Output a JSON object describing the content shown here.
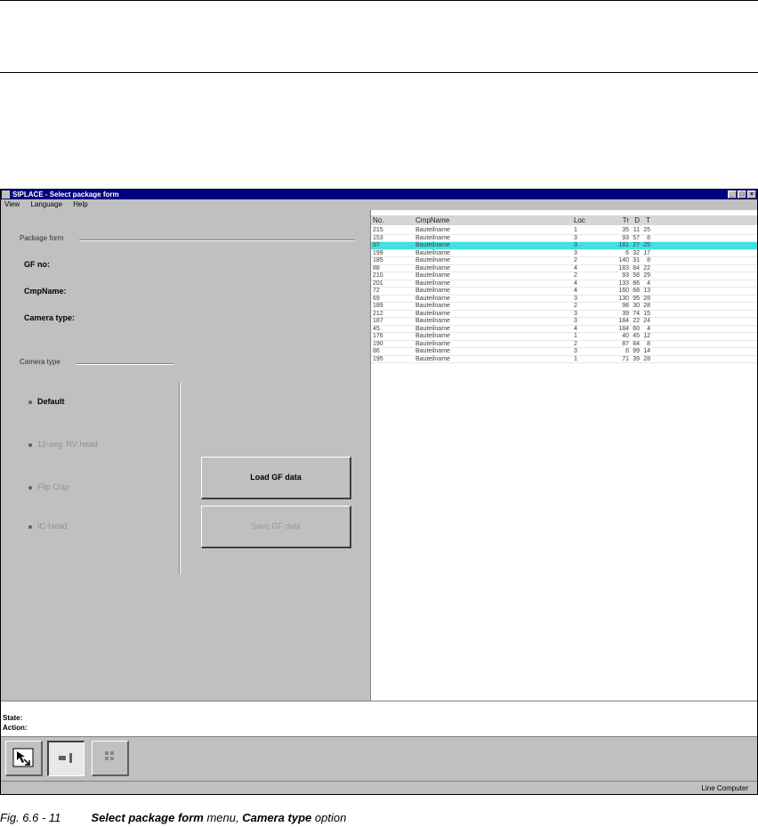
{
  "window": {
    "title": "SIPLACE - Select package form",
    "menu": [
      "View",
      "Language",
      "Help"
    ]
  },
  "left": {
    "group_package": "Package form",
    "fields": [
      "GF no:",
      "CmpName:",
      "Camera type:"
    ],
    "group_camera": "Camera type",
    "radios": [
      {
        "label": "Default",
        "enabled": true
      },
      {
        "label": "12-seg. RV head",
        "enabled": false
      },
      {
        "label": "Flip Chip",
        "enabled": false
      },
      {
        "label": "IC-Head",
        "enabled": false
      }
    ],
    "load_button": "Load GF data",
    "save_button": "Save GF data"
  },
  "list": {
    "columns": {
      "no": "No.",
      "name": "CmpName",
      "loc": "Loc",
      "tr": "Tr",
      "d": "D",
      "t": "T"
    },
    "rows": [
      {
        "no": "215",
        "name": "Bauteilname",
        "loc": "1",
        "tr": "35",
        "d": "11",
        "t": "25"
      },
      {
        "no": "153",
        "name": "Bauteilname",
        "loc": "3",
        "tr": "93",
        "d": "57",
        "t": "8"
      },
      {
        "no": "97",
        "name": "Bauteilname",
        "loc": "3",
        "tr": "181",
        "d": "27",
        "t": "25"
      },
      {
        "no": "199",
        "name": "Bauteilname",
        "loc": "3",
        "tr": "6",
        "d": "32",
        "t": "17"
      },
      {
        "no": "185",
        "name": "Bauteilname",
        "loc": "2",
        "tr": "140",
        "d": "31",
        "t": "8"
      },
      {
        "no": "88",
        "name": "Bauteilname",
        "loc": "4",
        "tr": "183",
        "d": "84",
        "t": "22"
      },
      {
        "no": "210",
        "name": "Bauteilname",
        "loc": "2",
        "tr": "93",
        "d": "58",
        "t": "29"
      },
      {
        "no": "201",
        "name": "Bauteilname",
        "loc": "4",
        "tr": "133",
        "d": "86",
        "t": "4"
      },
      {
        "no": "72",
        "name": "Bauteilname",
        "loc": "4",
        "tr": "160",
        "d": "68",
        "t": "13"
      },
      {
        "no": "69",
        "name": "Bauteilname",
        "loc": "3",
        "tr": "130",
        "d": "95",
        "t": "28"
      },
      {
        "no": "189",
        "name": "Bauteilname",
        "loc": "2",
        "tr": "98",
        "d": "30",
        "t": "28"
      },
      {
        "no": "212",
        "name": "Bauteilname",
        "loc": "3",
        "tr": "39",
        "d": "74",
        "t": "15"
      },
      {
        "no": "187",
        "name": "Bauteilname",
        "loc": "3",
        "tr": "184",
        "d": "22",
        "t": "24"
      },
      {
        "no": "45",
        "name": "Bauteilname",
        "loc": "4",
        "tr": "184",
        "d": "60",
        "t": "4"
      },
      {
        "no": "176",
        "name": "Bauteilname",
        "loc": "1",
        "tr": "40",
        "d": "45",
        "t": "12"
      },
      {
        "no": "190",
        "name": "Bauteilname",
        "loc": "2",
        "tr": "87",
        "d": "84",
        "t": "8"
      },
      {
        "no": "86",
        "name": "Bauteilname",
        "loc": "3",
        "tr": "6",
        "d": "99",
        "t": "14"
      },
      {
        "no": "195",
        "name": "Bauteilname",
        "loc": "1",
        "tr": "71",
        "d": "39",
        "t": "28"
      }
    ],
    "selected_index": 2,
    "selection_color": "#40e0e0"
  },
  "status": {
    "state": "State:",
    "action": "Action:"
  },
  "statusbar": {
    "right": "Line Computer"
  },
  "caption": {
    "fig": "Fig. 6.6 - 11",
    "bold1": "Select package form",
    "mid": " menu, ",
    "bold2": "Camera type",
    "end": " option"
  }
}
